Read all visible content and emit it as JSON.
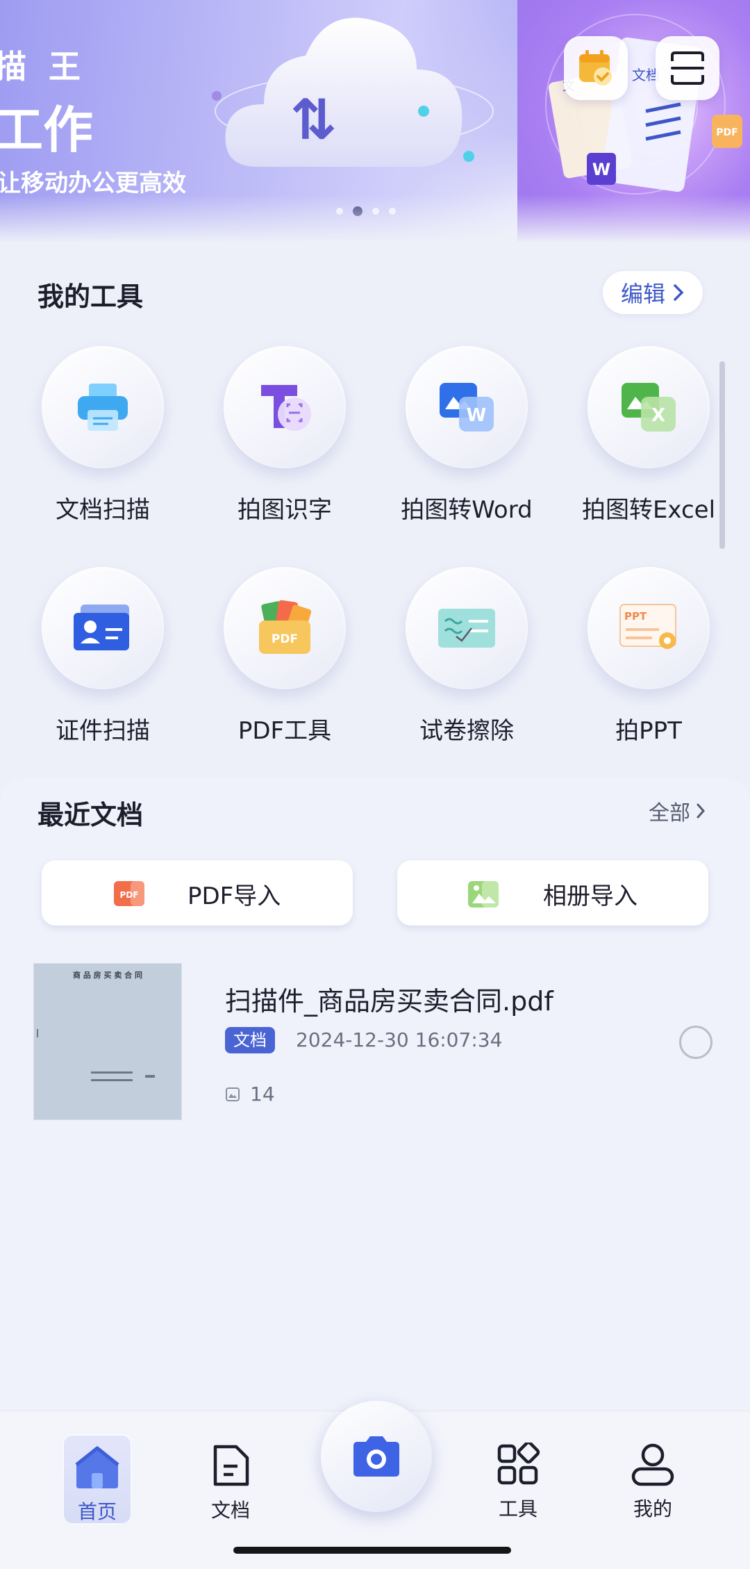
{
  "banner": {
    "line1": "描 王",
    "line2": "工作",
    "line3": "让移动办公更高效",
    "slides": 4,
    "active_slide": 2,
    "doc_badge": "文档",
    "doc_badge2": "文",
    "pdf_badge": "PDF",
    "word_badge": "W"
  },
  "top_actions": {
    "calendar_icon": "calendar-check-icon",
    "menu_icon": "scan-menu-icon"
  },
  "tools": {
    "title": "我的工具",
    "edit_label": "编辑",
    "items": [
      {
        "label": "文档扫描",
        "icon": "printer-icon"
      },
      {
        "label": "拍图识字",
        "icon": "text-recognize-icon"
      },
      {
        "label": "拍图转Word",
        "icon": "word-icon"
      },
      {
        "label": "拍图转Excel",
        "icon": "excel-icon"
      },
      {
        "label": "证件扫描",
        "icon": "id-card-icon"
      },
      {
        "label": "PDF工具",
        "icon": "pdf-folder-icon"
      },
      {
        "label": "试卷擦除",
        "icon": "paper-erase-icon"
      },
      {
        "label": "拍PPT",
        "icon": "ppt-icon"
      }
    ],
    "pdf_icon_text": "PDF",
    "ppt_icon_text": "PPT",
    "word_icon_text": "W",
    "excel_icon_text": "X"
  },
  "recent": {
    "title": "最近文档",
    "all_label": "全部",
    "pdf_import": "PDF导入",
    "pdf_import_icon_text": "PDF",
    "album_import": "相册导入",
    "documents": [
      {
        "name": "扫描件_商品房买卖合同.pdf",
        "tag": "文档",
        "date": "2024-12-30 16:07:34",
        "pages": "14",
        "thumb_title": "商 品 房 买 卖 合 同"
      }
    ]
  },
  "nav": {
    "home": "首页",
    "docs": "文档",
    "tools": "工具",
    "mine": "我的",
    "camera_icon": "camera-icon"
  },
  "colors": {
    "accent": "#3d57c8",
    "background": "#eef0f9",
    "tag": "#4b64d4"
  }
}
